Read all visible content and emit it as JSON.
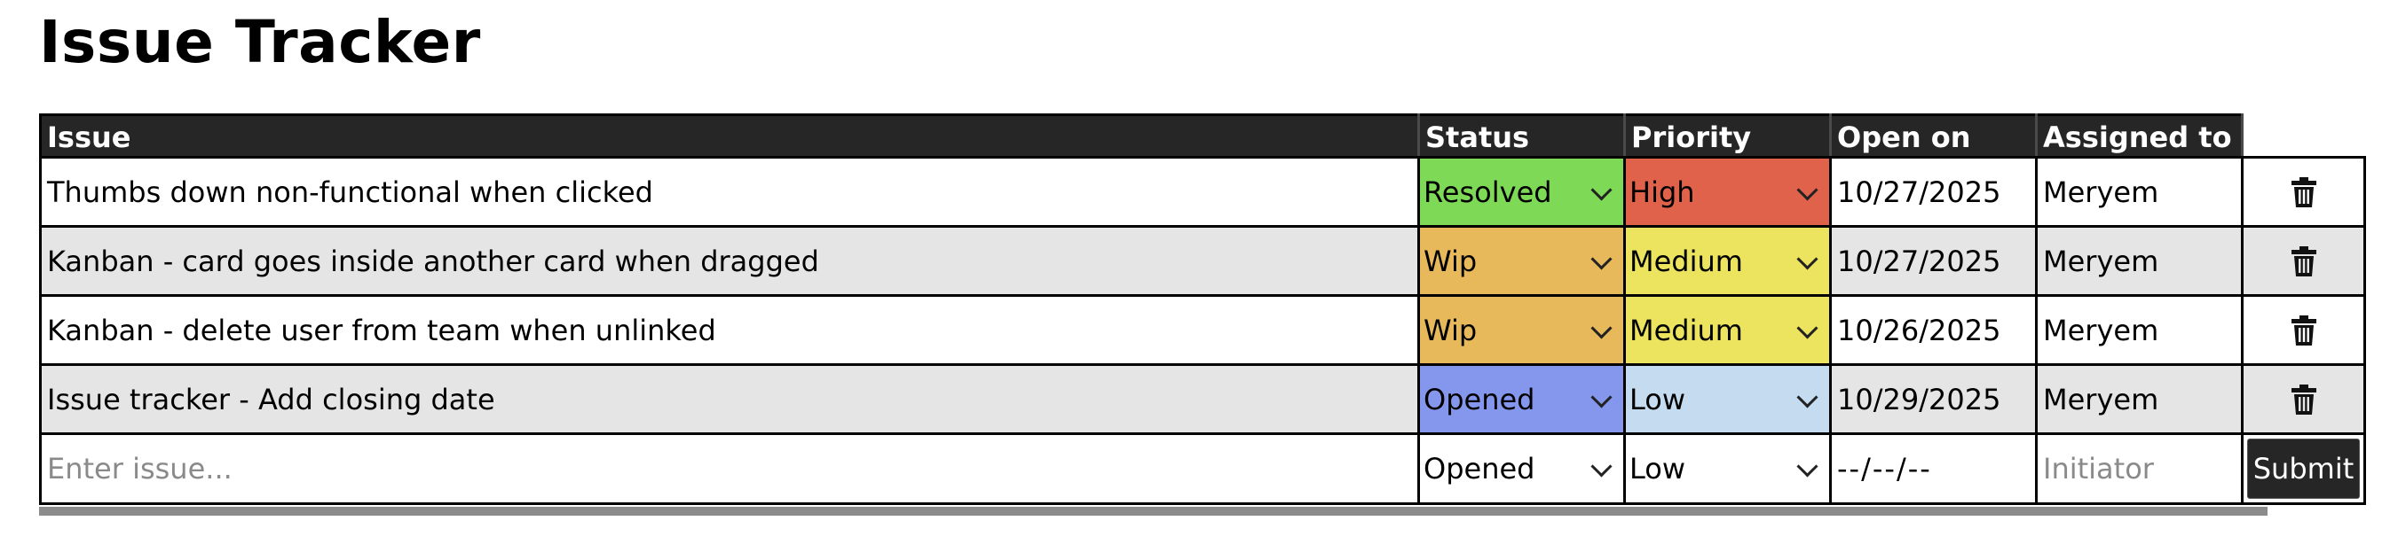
{
  "page": {
    "title": "Issue Tracker"
  },
  "table": {
    "headers": [
      "Issue",
      "Status",
      "Priority",
      "Open on",
      "Assigned to"
    ],
    "rows": [
      {
        "issue": "Thumbs down non-functional when clicked",
        "status": "Resolved",
        "priority": "High",
        "open_on": "10/27/2025",
        "assigned_to": "Meryem"
      },
      {
        "issue": "Kanban - card goes inside another card when dragged",
        "status": "Wip",
        "priority": "Medium",
        "open_on": "10/27/2025",
        "assigned_to": "Meryem"
      },
      {
        "issue": "Kanban - delete user from team when unlinked",
        "status": "Wip",
        "priority": "Medium",
        "open_on": "10/26/2025",
        "assigned_to": "Meryem"
      },
      {
        "issue": "Issue tracker - Add closing date",
        "status": "Opened",
        "priority": "Low",
        "open_on": "10/29/2025",
        "assigned_to": "Meryem"
      }
    ]
  },
  "entry": {
    "issue_placeholder": "Enter issue...",
    "status_value": "Opened",
    "priority_value": "Low",
    "date_placeholder": "--/--/--",
    "initiator_placeholder": "Initiator",
    "submit_label": "Submit"
  },
  "colors": {
    "status": {
      "Resolved": "#7ed957",
      "Wip": "#e8b95a",
      "Opened": "#8497ec"
    },
    "priority": {
      "High": "#e0624b",
      "Medium": "#ece35f",
      "Low": "#c4dbf0"
    }
  },
  "icons": {
    "delete": "trash-icon",
    "dropdown": "chevron-down-icon"
  }
}
